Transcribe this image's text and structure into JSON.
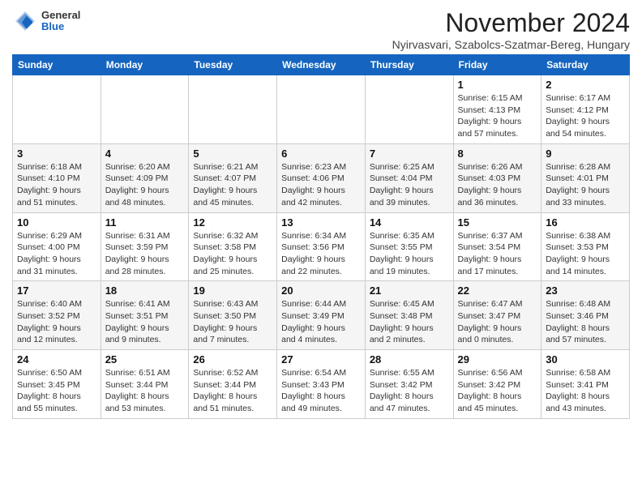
{
  "logo": {
    "general": "General",
    "blue": "Blue"
  },
  "title": "November 2024",
  "subtitle": "Nyirvasvari, Szabolcs-Szatmar-Bereg, Hungary",
  "days_of_week": [
    "Sunday",
    "Monday",
    "Tuesday",
    "Wednesday",
    "Thursday",
    "Friday",
    "Saturday"
  ],
  "weeks": [
    [
      {
        "day": "",
        "info": ""
      },
      {
        "day": "",
        "info": ""
      },
      {
        "day": "",
        "info": ""
      },
      {
        "day": "",
        "info": ""
      },
      {
        "day": "",
        "info": ""
      },
      {
        "day": "1",
        "info": "Sunrise: 6:15 AM\nSunset: 4:13 PM\nDaylight: 9 hours\nand 57 minutes."
      },
      {
        "day": "2",
        "info": "Sunrise: 6:17 AM\nSunset: 4:12 PM\nDaylight: 9 hours\nand 54 minutes."
      }
    ],
    [
      {
        "day": "3",
        "info": "Sunrise: 6:18 AM\nSunset: 4:10 PM\nDaylight: 9 hours\nand 51 minutes."
      },
      {
        "day": "4",
        "info": "Sunrise: 6:20 AM\nSunset: 4:09 PM\nDaylight: 9 hours\nand 48 minutes."
      },
      {
        "day": "5",
        "info": "Sunrise: 6:21 AM\nSunset: 4:07 PM\nDaylight: 9 hours\nand 45 minutes."
      },
      {
        "day": "6",
        "info": "Sunrise: 6:23 AM\nSunset: 4:06 PM\nDaylight: 9 hours\nand 42 minutes."
      },
      {
        "day": "7",
        "info": "Sunrise: 6:25 AM\nSunset: 4:04 PM\nDaylight: 9 hours\nand 39 minutes."
      },
      {
        "day": "8",
        "info": "Sunrise: 6:26 AM\nSunset: 4:03 PM\nDaylight: 9 hours\nand 36 minutes."
      },
      {
        "day": "9",
        "info": "Sunrise: 6:28 AM\nSunset: 4:01 PM\nDaylight: 9 hours\nand 33 minutes."
      }
    ],
    [
      {
        "day": "10",
        "info": "Sunrise: 6:29 AM\nSunset: 4:00 PM\nDaylight: 9 hours\nand 31 minutes."
      },
      {
        "day": "11",
        "info": "Sunrise: 6:31 AM\nSunset: 3:59 PM\nDaylight: 9 hours\nand 28 minutes."
      },
      {
        "day": "12",
        "info": "Sunrise: 6:32 AM\nSunset: 3:58 PM\nDaylight: 9 hours\nand 25 minutes."
      },
      {
        "day": "13",
        "info": "Sunrise: 6:34 AM\nSunset: 3:56 PM\nDaylight: 9 hours\nand 22 minutes."
      },
      {
        "day": "14",
        "info": "Sunrise: 6:35 AM\nSunset: 3:55 PM\nDaylight: 9 hours\nand 19 minutes."
      },
      {
        "day": "15",
        "info": "Sunrise: 6:37 AM\nSunset: 3:54 PM\nDaylight: 9 hours\nand 17 minutes."
      },
      {
        "day": "16",
        "info": "Sunrise: 6:38 AM\nSunset: 3:53 PM\nDaylight: 9 hours\nand 14 minutes."
      }
    ],
    [
      {
        "day": "17",
        "info": "Sunrise: 6:40 AM\nSunset: 3:52 PM\nDaylight: 9 hours\nand 12 minutes."
      },
      {
        "day": "18",
        "info": "Sunrise: 6:41 AM\nSunset: 3:51 PM\nDaylight: 9 hours\nand 9 minutes."
      },
      {
        "day": "19",
        "info": "Sunrise: 6:43 AM\nSunset: 3:50 PM\nDaylight: 9 hours\nand 7 minutes."
      },
      {
        "day": "20",
        "info": "Sunrise: 6:44 AM\nSunset: 3:49 PM\nDaylight: 9 hours\nand 4 minutes."
      },
      {
        "day": "21",
        "info": "Sunrise: 6:45 AM\nSunset: 3:48 PM\nDaylight: 9 hours\nand 2 minutes."
      },
      {
        "day": "22",
        "info": "Sunrise: 6:47 AM\nSunset: 3:47 PM\nDaylight: 9 hours\nand 0 minutes."
      },
      {
        "day": "23",
        "info": "Sunrise: 6:48 AM\nSunset: 3:46 PM\nDaylight: 8 hours\nand 57 minutes."
      }
    ],
    [
      {
        "day": "24",
        "info": "Sunrise: 6:50 AM\nSunset: 3:45 PM\nDaylight: 8 hours\nand 55 minutes."
      },
      {
        "day": "25",
        "info": "Sunrise: 6:51 AM\nSunset: 3:44 PM\nDaylight: 8 hours\nand 53 minutes."
      },
      {
        "day": "26",
        "info": "Sunrise: 6:52 AM\nSunset: 3:44 PM\nDaylight: 8 hours\nand 51 minutes."
      },
      {
        "day": "27",
        "info": "Sunrise: 6:54 AM\nSunset: 3:43 PM\nDaylight: 8 hours\nand 49 minutes."
      },
      {
        "day": "28",
        "info": "Sunrise: 6:55 AM\nSunset: 3:42 PM\nDaylight: 8 hours\nand 47 minutes."
      },
      {
        "day": "29",
        "info": "Sunrise: 6:56 AM\nSunset: 3:42 PM\nDaylight: 8 hours\nand 45 minutes."
      },
      {
        "day": "30",
        "info": "Sunrise: 6:58 AM\nSunset: 3:41 PM\nDaylight: 8 hours\nand 43 minutes."
      }
    ]
  ]
}
